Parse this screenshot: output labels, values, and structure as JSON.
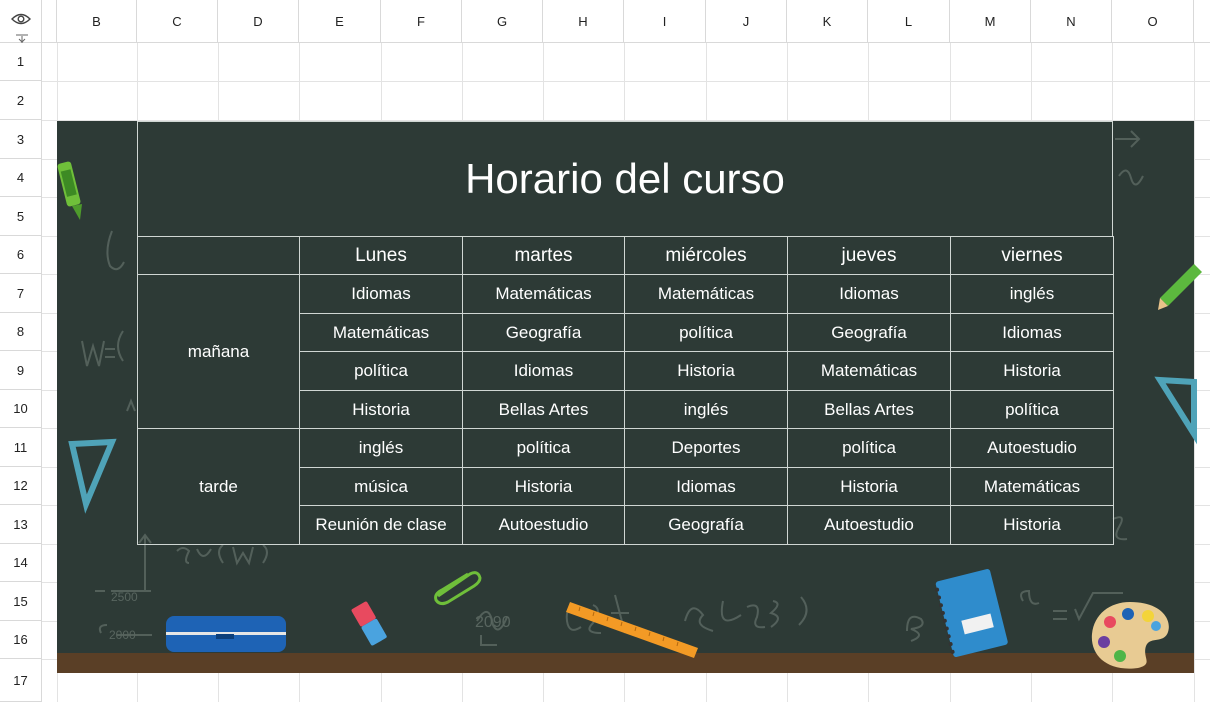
{
  "columns": [
    "B",
    "C",
    "D",
    "E",
    "F",
    "G",
    "H",
    "I",
    "J",
    "K",
    "L",
    "M",
    "N",
    "O"
  ],
  "rows": [
    "1",
    "2",
    "3",
    "4",
    "5",
    "6",
    "7",
    "8",
    "9",
    "10",
    "11",
    "12",
    "13",
    "14",
    "15",
    "16",
    "17"
  ],
  "schedule": {
    "title": "Horario del curso",
    "days": [
      "Lunes",
      "martes",
      "miércoles",
      "jueves",
      "viernes"
    ],
    "periods": [
      {
        "label": "mañana",
        "slots": [
          [
            "Idiomas",
            "Matemáticas",
            "Matemáticas",
            "Idiomas",
            "inglés"
          ],
          [
            "Matemáticas",
            "Geografía",
            "política",
            "Geografía",
            "Idiomas"
          ],
          [
            "política",
            "Idiomas",
            "Historia",
            "Matemáticas",
            "Historia"
          ],
          [
            "Historia",
            "Bellas Artes",
            "inglés",
            "Bellas Artes",
            "política"
          ]
        ]
      },
      {
        "label": "tarde",
        "slots": [
          [
            "inglés",
            "política",
            "Deportes",
            "política",
            "Autoestudio"
          ],
          [
            "música",
            "Historia",
            "Idiomas",
            "Historia",
            "Matemáticas"
          ],
          [
            "Reunión de clase",
            "Autoestudio",
            "Geografía",
            "Autoestudio",
            "Historia"
          ]
        ]
      }
    ]
  },
  "colors": {
    "board": "#2d3a36",
    "floor": "#5a3f26",
    "chalk": "#ffffff"
  },
  "icons": [
    "eye-icon",
    "freeze-icon",
    "crayon-icon",
    "pencil-icon",
    "ruler-triangle-icon",
    "pencil-case-icon",
    "eraser-icon",
    "paperclip-icon",
    "ruler-icon",
    "notebook-icon",
    "palette-icon"
  ]
}
